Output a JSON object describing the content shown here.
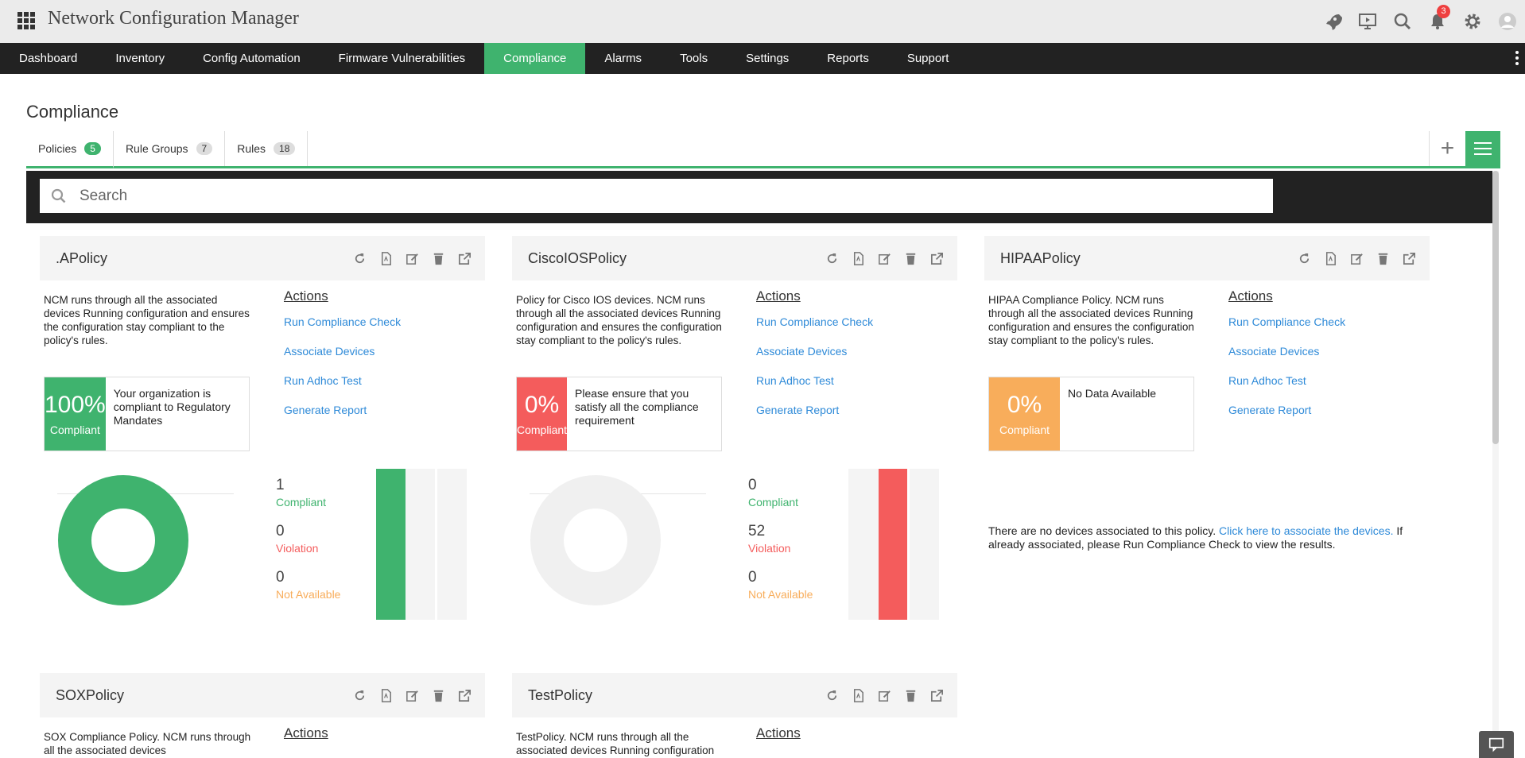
{
  "app": {
    "title": "Network Configuration Manager",
    "notifications": "3"
  },
  "nav": [
    "Dashboard",
    "Inventory",
    "Config Automation",
    "Firmware Vulnerabilities",
    "Compliance",
    "Alarms",
    "Tools",
    "Settings",
    "Reports",
    "Support"
  ],
  "page": {
    "title": "Compliance"
  },
  "tabs": [
    {
      "label": "Policies",
      "count": "5"
    },
    {
      "label": "Rule Groups",
      "count": "7"
    },
    {
      "label": "Rules",
      "count": "18"
    }
  ],
  "search": {
    "placeholder": "Search"
  },
  "colors": {
    "green": "#3fb36e",
    "red": "#f45c5c",
    "orange": "#f8ad5b",
    "grey": "#f0f0f0",
    "link": "#2e8ad8"
  },
  "actions_label": "Actions",
  "action_links": [
    "Run Compliance Check",
    "Associate Devices",
    "Run Adhoc Test",
    "Generate Report"
  ],
  "stat_labels": {
    "compliant": "Compliant",
    "violation": "Violation",
    "na": "Not Available"
  },
  "policies": [
    {
      "name": ".APolicy",
      "description": "NCM runs through all the associated devices Running configuration and ensures the configuration stay compliant to the policy's rules.",
      "percent": "100%",
      "percent_label": "Compliant",
      "message": "Your organization is compliant to Regulatory Mandates",
      "compliant": "1",
      "violation": "0",
      "na": "0"
    },
    {
      "name": "CiscoIOSPolicy",
      "description": "Policy for Cisco IOS devices. NCM runs through all the associated devices Running configuration and ensures the configuration stay compliant to the policy's rules.",
      "percent": "0%",
      "percent_label": "Compliant",
      "message": "Please ensure that you satisfy all the compliance requirement",
      "compliant": "0",
      "violation": "52",
      "na": "0"
    },
    {
      "name": "HIPAAPolicy",
      "description": "HIPAA Compliance Policy. NCM runs through all the associated devices Running configuration and ensures the configuration stay compliant to the policy's rules.",
      "percent": "0%",
      "percent_label": "Compliant",
      "message": "No Data Available",
      "no_devices_text": "There are no devices associated to this policy.",
      "no_devices_link": "Click here to associate the devices.",
      "no_devices_tail": "If already associated, please Run Compliance Check to view the results."
    },
    {
      "name": "SOXPolicy",
      "description": "SOX Compliance Policy. NCM runs through all the associated devices"
    },
    {
      "name": "TestPolicy",
      "description": "TestPolicy. NCM runs through all the associated devices Running configuration"
    }
  ]
}
